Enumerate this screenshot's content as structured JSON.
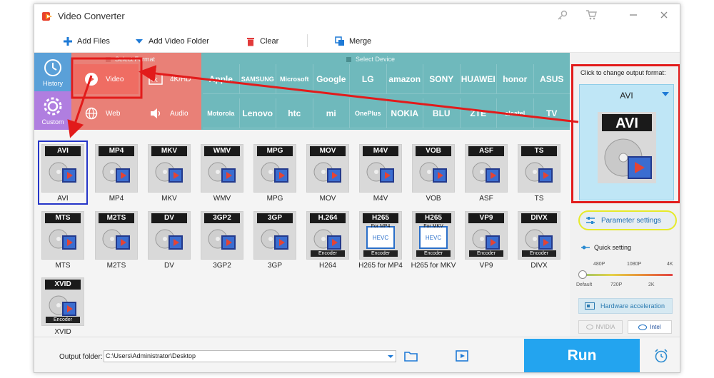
{
  "window": {
    "title": "Video Converter"
  },
  "toolbar": {
    "add_files": "Add Files",
    "add_video_folder": "Add Video Folder",
    "clear": "Clear",
    "merge": "Merge"
  },
  "side_tabs": [
    {
      "label": "History",
      "icon": "history-icon"
    },
    {
      "label": "Custom",
      "icon": "custom-gear-icon"
    }
  ],
  "sections": {
    "select_format": "Select Format",
    "select_device": "Select Device"
  },
  "categories": [
    {
      "label": "Video",
      "icon": "play-icon"
    },
    {
      "label": "4K/HD",
      "icon": "4k-icon"
    },
    {
      "label": "Web",
      "icon": "web-icon"
    },
    {
      "label": "Audio",
      "icon": "audio-icon"
    }
  ],
  "brands_row1": [
    "Apple",
    "SAMSUNG",
    "Microsoft",
    "Google",
    "LG",
    "amazon",
    "SONY",
    "HUAWEI",
    "honor",
    "ASUS"
  ],
  "brands_row2": [
    "Motorola",
    "Lenovo",
    "htc",
    "mi",
    "OnePlus",
    "NOKIA",
    "BLU",
    "ZTE",
    "alcatel",
    "TV"
  ],
  "formats": [
    {
      "tag": "AVI",
      "label": "AVI",
      "selected": true
    },
    {
      "tag": "MP4",
      "label": "MP4"
    },
    {
      "tag": "MKV",
      "label": "MKV"
    },
    {
      "tag": "WMV",
      "label": "WMV"
    },
    {
      "tag": "MPG",
      "label": "MPG"
    },
    {
      "tag": "MOV",
      "label": "MOV"
    },
    {
      "tag": "M4V",
      "label": "M4V"
    },
    {
      "tag": "VOB",
      "label": "VOB"
    },
    {
      "tag": "ASF",
      "label": "ASF"
    },
    {
      "tag": "TS",
      "label": "TS"
    },
    {
      "tag": "MTS",
      "label": "MTS"
    },
    {
      "tag": "M2TS",
      "label": "M2TS"
    },
    {
      "tag": "DV",
      "label": "DV"
    },
    {
      "tag": "3GP2",
      "label": "3GP2"
    },
    {
      "tag": "3GP",
      "label": "3GP"
    },
    {
      "tag": "H.264",
      "label": "H264",
      "encoder": "Encoder"
    },
    {
      "tag": "H265",
      "label": "H265 for MP4",
      "sub": "For MP4",
      "encoder": "Encoder"
    },
    {
      "tag": "H265",
      "label": "H265 for MKV",
      "sub": "For MKV",
      "encoder": "Encoder"
    },
    {
      "tag": "VP9",
      "label": "VP9",
      "encoder": "Encoder"
    },
    {
      "tag": "DIVX",
      "label": "DIVX",
      "encoder": "Encoder"
    },
    {
      "tag": "XVID",
      "label": "XVID",
      "encoder": "Encoder"
    }
  ],
  "output": {
    "caption": "Click to change output format:",
    "format": "AVI",
    "format_badge": "AVI"
  },
  "param_settings": "Parameter settings",
  "quick_setting": {
    "label": "Quick setting",
    "top_marks": [
      "480P",
      "1080P",
      "4K"
    ],
    "bottom_marks": [
      "Default",
      "720P",
      "2K"
    ],
    "level": 0
  },
  "hardware": {
    "label": "Hardware acceleration",
    "nvidia": "NVIDIA",
    "intel": "Intel"
  },
  "bottom": {
    "output_folder_label": "Output folder:",
    "output_folder_value": "C:\\Users\\Administrator\\Desktop",
    "run": "Run"
  },
  "colors": {
    "accent": "#23a4ef",
    "device_teal": "#6fb9bc",
    "format_pink": "#e98077",
    "annotation_red": "#e21b1b",
    "highlight_yellow": "#e6ea2a",
    "selection_blue": "#2535c8"
  }
}
